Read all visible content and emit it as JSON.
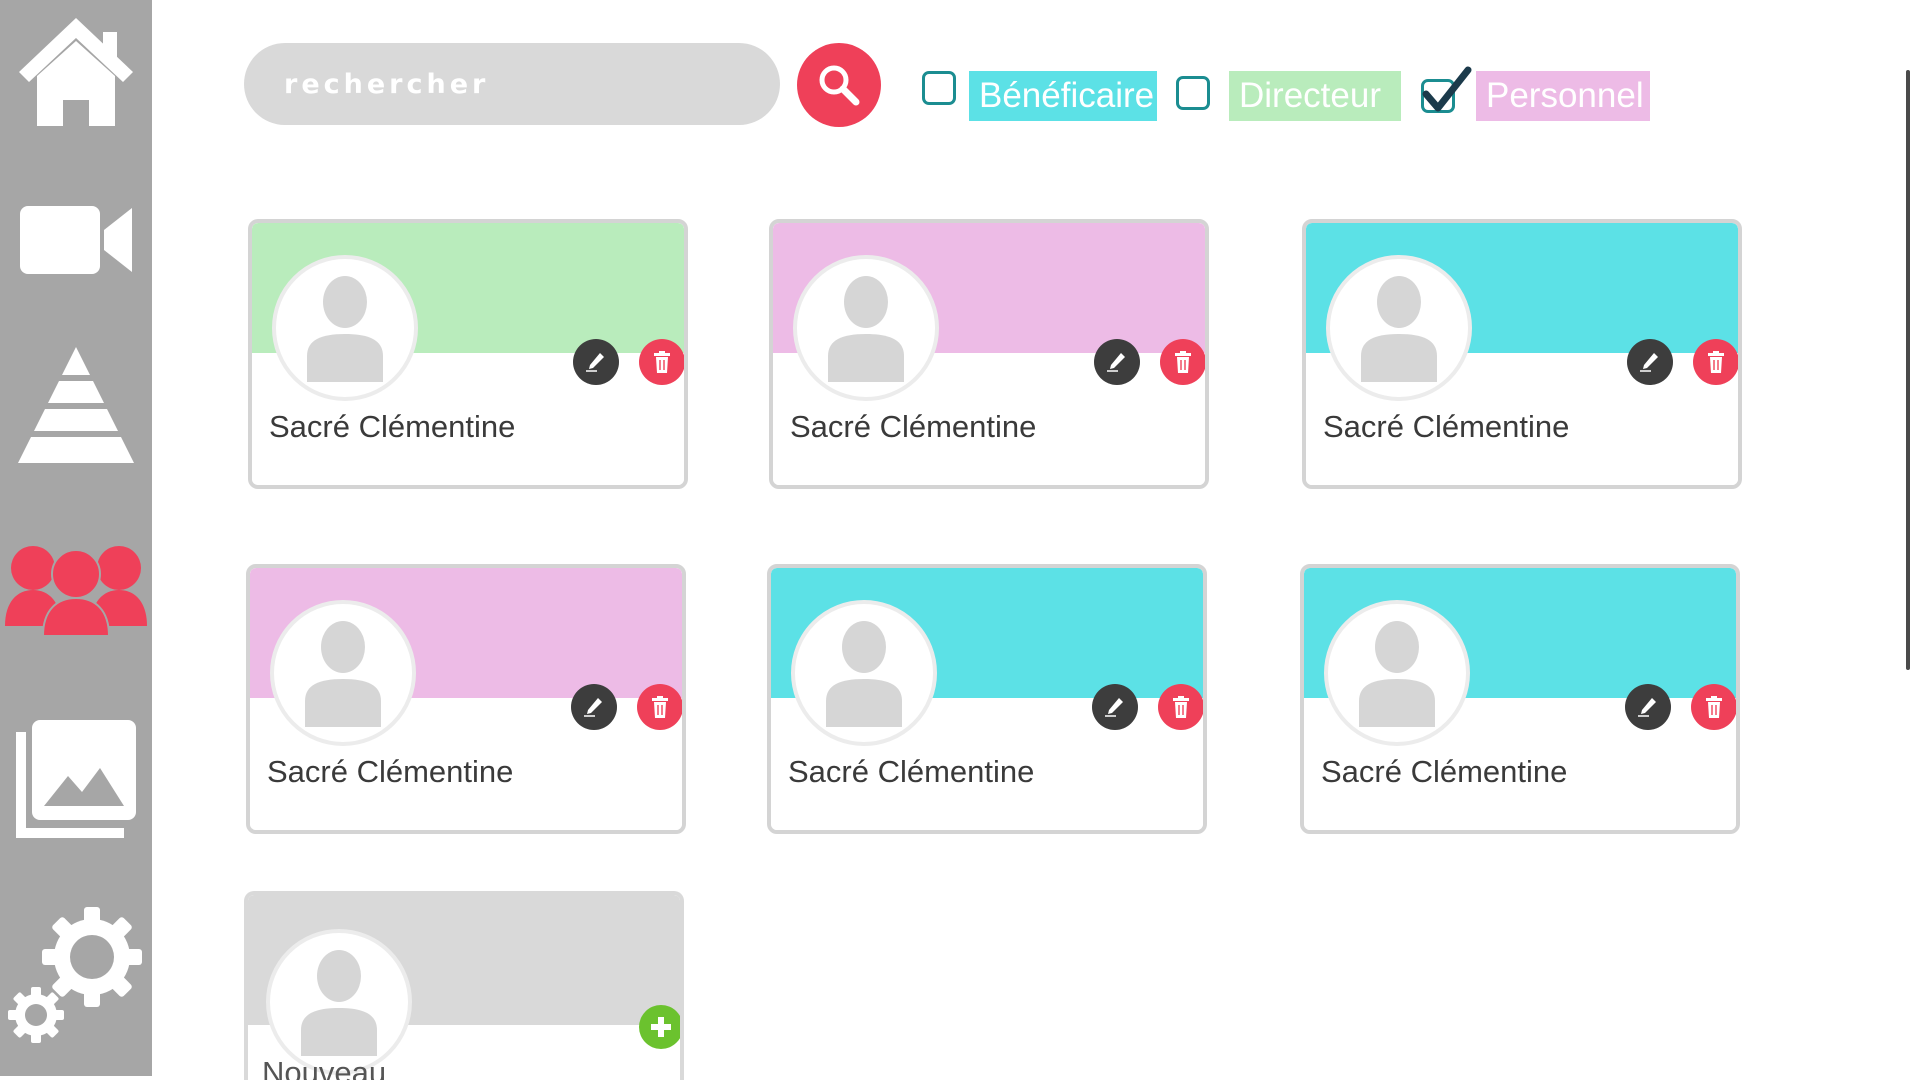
{
  "sidebar": {
    "items": [
      {
        "id": "home",
        "icon": "home-icon"
      },
      {
        "id": "video",
        "icon": "video-camera-icon"
      },
      {
        "id": "pyramid",
        "icon": "pyramid-icon"
      },
      {
        "id": "users",
        "icon": "users-icon",
        "active": true
      },
      {
        "id": "gallery",
        "icon": "gallery-icon"
      },
      {
        "id": "settings",
        "icon": "gears-icon"
      }
    ],
    "active_color": "#ef4059"
  },
  "search": {
    "placeholder": "rechercher",
    "button_icon": "search-icon"
  },
  "filters": [
    {
      "label": "Bénéficaire",
      "checked": false,
      "color": "#5ce1e6"
    },
    {
      "label": "Directeur",
      "checked": false,
      "color": "#b9ecbc"
    },
    {
      "label": "Personnel",
      "checked": true,
      "color": "#edbbe6"
    }
  ],
  "cards": [
    {
      "name": "Sacré Clémentine",
      "color": "#b9ecbc"
    },
    {
      "name": "Sacré Clémentine",
      "color": "#edbbe6"
    },
    {
      "name": "Sacré Clémentine",
      "color": "#5ce1e6"
    },
    {
      "name": "Sacré Clémentine",
      "color": "#edbbe6"
    },
    {
      "name": "Sacré Clémentine",
      "color": "#5ce1e6"
    },
    {
      "name": "Sacré Clémentine",
      "color": "#5ce1e6"
    }
  ],
  "new_card": {
    "label": "Nouveau",
    "color": "#d9d9d9",
    "icon": "plus-icon"
  }
}
